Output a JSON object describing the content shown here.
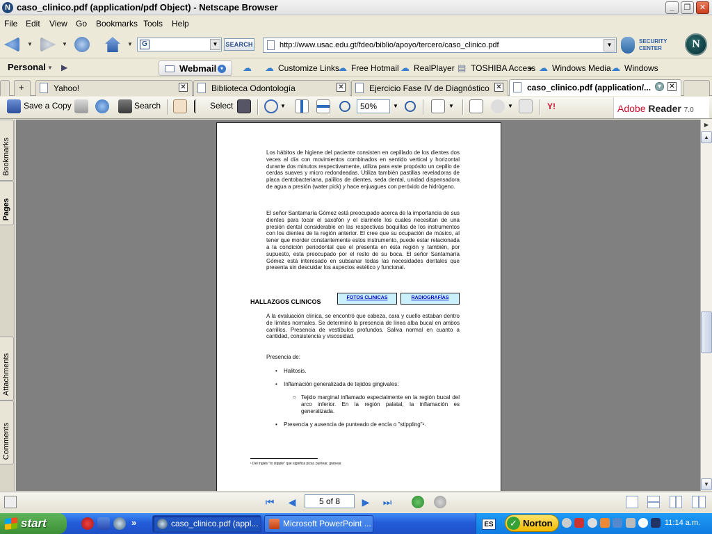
{
  "window": {
    "title": "caso_clinico.pdf (application/pdf Object) - Netscape Browser",
    "minimize": "_",
    "restore": "❐",
    "close": "✕"
  },
  "menu": [
    "File",
    "Edit",
    "View",
    "Go",
    "Bookmarks",
    "Tools",
    "Help"
  ],
  "navbar": {
    "search_button": "SEARCH",
    "search_engine_icon": "G",
    "url": "http://www.usac.edu.gt/fdeo/biblio/apoyo/tercero/caso_clinico.pdf",
    "security_center": "SECURITY CENTER",
    "netscape_logo": "N"
  },
  "personal_toolbar": {
    "personal": "Personal",
    "webmail": "Webmail",
    "links": [
      "Customize Links",
      "Free Hotmail",
      "RealPlayer",
      "TOSHIBA Access",
      "Windows Media",
      "Windows"
    ]
  },
  "tabs": [
    {
      "label": "Yahoo!",
      "active": false
    },
    {
      "label": "Biblioteca Odontología",
      "active": false
    },
    {
      "label": "Ejercicio Fase IV de Diagnóstico",
      "active": false
    },
    {
      "label": "caso_clinico.pdf (application/...",
      "active": true
    }
  ],
  "acrobat_toolbar": {
    "save_copy": "Save a Copy",
    "search": "Search",
    "select": "Select",
    "zoom": "50%",
    "brand": "Adobe",
    "brand_bold": "Reader",
    "version": "7.0"
  },
  "side_tabs": [
    "Bookmarks",
    "Pages",
    "Attachments",
    "Comments"
  ],
  "document": {
    "para1": "Los hábitos de higiene del paciente consisten en cepillado de los dientes dos veces al día con movimientos combinados en sentido vertical y horizontal durante dos minutos respectivamente, utiliza para este propósito un cepillo de cerdas suaves y micro redondeadas. Utiliza también pastillas reveladoras de placa dentobacteriana, palillos de dientes, seda dental, unidad dispensadora de agua a presión (water pick) y hace enjuagues con peróxido de hidrógeno.",
    "para2": "El señor Santamaría Gómez está preocupado acerca de la importancia de sus dientes para tocar el saxofón y el clarinete los cuales necesitan de una presión dental considerable en las respectivas boquillas de los instrumentos con los dientes de la región anterior. El cree que su ocupación de músico, al tener que morder constantemente estos instrumento, puede estar relacionada a la condición periodontal que el presenta en ésta región y también, por supuesto, esta preocupado por el resto de su boca. El señor Santamaría Gómez está interesado en subsanar todas las necesidades dentales que presenta sin descuidar los aspectos estético y funcional.",
    "heading": "HALLAZGOS CLINICOS",
    "link_fotos": "FOTOS CLINICAS",
    "link_radio": "RADIOGRAFÍAS",
    "para3": "A la evaluación clínica, se encontró que cabeza, cara y cuello estaban dentro de límites normales. Se determinó la presencia de línea alba bucal en ambos carrillos. Presencia de vestíbulos profundos. Saliva normal en cuanto a cantidad, consistencia y viscosidad.",
    "presencia": "Presencia de:",
    "bullet1": "Halitosis.",
    "bullet2": "Inflamación generalizada de tejidos gingivales:",
    "sub_bullet": "Tejido marginal inflamado especialmente en la región bucal del arco inferior. En la región palatal, la inflamación es generalizada.",
    "bullet3": "Presencia y ausencia de punteado de encía o \"stippling\"¹.",
    "footnote": "¹ Del inglés \"to stipple\" que significa picar, puntear, granear."
  },
  "statusbar": {
    "page": "5 of 8"
  },
  "taskbar": {
    "start": "start",
    "chevron": "»",
    "items": [
      {
        "label": "caso_clinico.pdf (appl...",
        "active": true
      },
      {
        "label": "Microsoft PowerPoint ...",
        "active": false
      }
    ],
    "lang": "ES",
    "norton": "Norton",
    "clock": "11:14 a.m."
  }
}
